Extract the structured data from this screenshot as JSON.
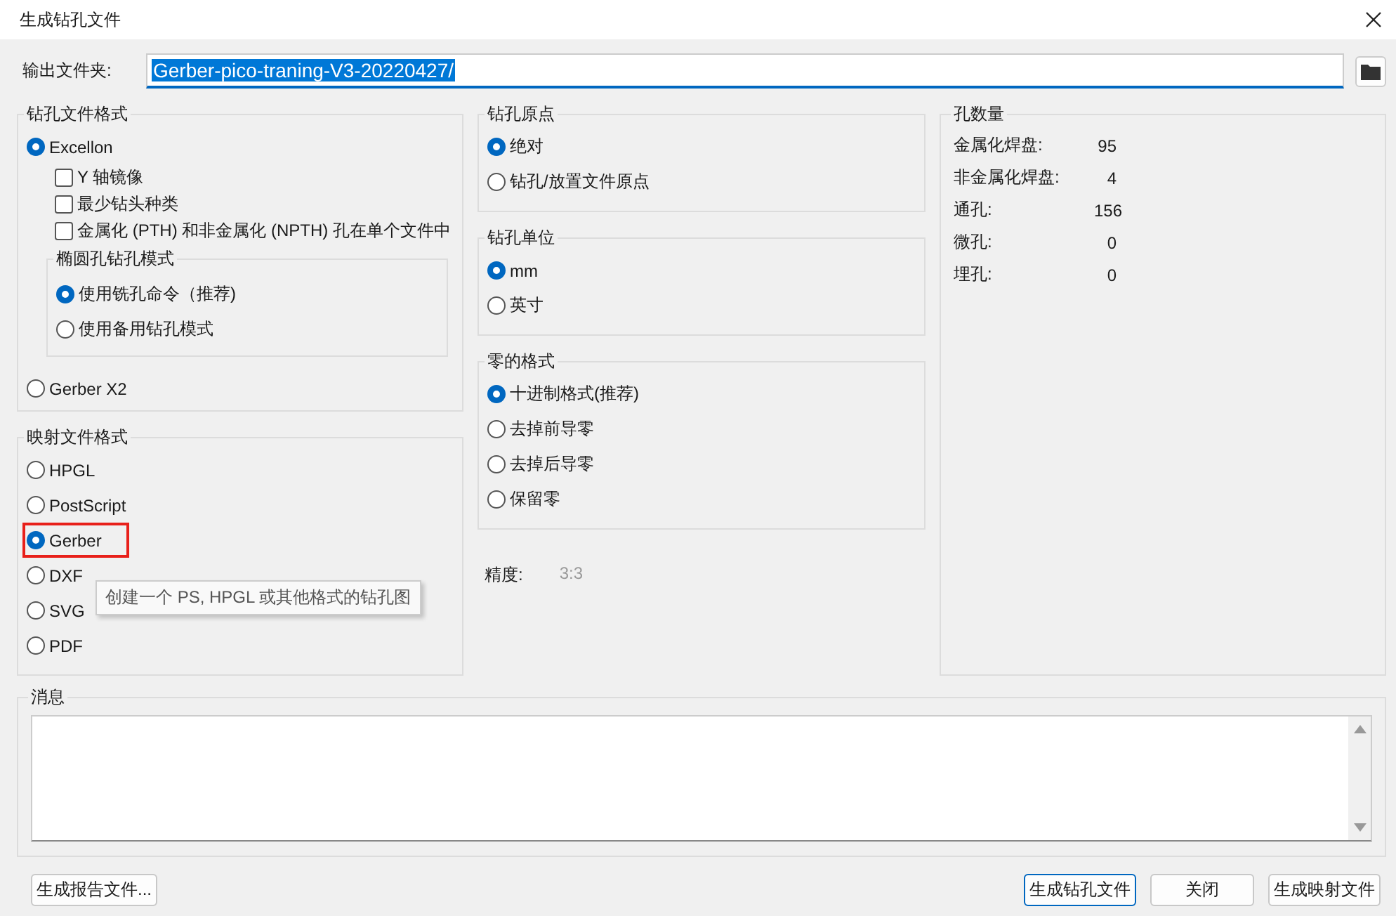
{
  "window": {
    "title": "生成钻孔文件"
  },
  "output_folder": {
    "label": "输出文件夹:",
    "value": "Gerber-pico-traning-V3-20220427/",
    "text_selected": true
  },
  "drill_file_format": {
    "title": "钻孔文件格式",
    "excellon": {
      "label": "Excellon",
      "selected": true
    },
    "checkboxes": [
      {
        "label": "Y 轴镜像",
        "checked": false
      },
      {
        "label": "最少钻头种类",
        "checked": false
      },
      {
        "label": "金属化 (PTH) 和非金属化 (NPTH) 孔在单个文件中",
        "checked": false
      }
    ],
    "oval_mode": {
      "title": "椭圆孔钻孔模式",
      "options": [
        {
          "label": "使用铣孔命令（推荐)",
          "selected": true
        },
        {
          "label": "使用备用钻孔模式",
          "selected": false
        }
      ]
    },
    "gerber_x2": {
      "label": "Gerber X2",
      "selected": false
    }
  },
  "map_file_format": {
    "title": "映射文件格式",
    "options": [
      {
        "label": "HPGL",
        "selected": false,
        "highlighted": false
      },
      {
        "label": "PostScript",
        "selected": false,
        "highlighted": false
      },
      {
        "label": "Gerber",
        "selected": true,
        "highlighted": true
      },
      {
        "label": "DXF",
        "selected": false,
        "highlighted": false
      },
      {
        "label": "SVG",
        "selected": false,
        "highlighted": false
      },
      {
        "label": "PDF",
        "selected": false,
        "highlighted": false
      }
    ]
  },
  "tooltip": {
    "text": "创建一个 PS, HPGL 或其他格式的钻孔图"
  },
  "drill_origin": {
    "title": "钻孔原点",
    "options": [
      {
        "label": "绝对",
        "selected": true
      },
      {
        "label": "钻孔/放置文件原点",
        "selected": false
      }
    ]
  },
  "drill_units": {
    "title": "钻孔单位",
    "options": [
      {
        "label": "mm",
        "selected": true
      },
      {
        "label": "英寸",
        "selected": false
      }
    ]
  },
  "zeros_format": {
    "title": "零的格式",
    "options": [
      {
        "label": "十进制格式(推荐)",
        "selected": true
      },
      {
        "label": "去掉前导零",
        "selected": false
      },
      {
        "label": "去掉后导零",
        "selected": false
      },
      {
        "label": "保留零",
        "selected": false
      }
    ]
  },
  "precision": {
    "label": "精度:",
    "value": "3:3",
    "disabled": true
  },
  "hole_counts": {
    "title": "孔数量",
    "rows": [
      {
        "label": "金属化焊盘:",
        "value": "95"
      },
      {
        "label": "非金属化焊盘:",
        "value": "4"
      },
      {
        "label": "通孔:",
        "value": "156"
      },
      {
        "label": "微孔:",
        "value": "0"
      },
      {
        "label": "埋孔:",
        "value": "0"
      }
    ]
  },
  "messages": {
    "title": "消息"
  },
  "buttons_left": [
    {
      "label": "生成报告文件...",
      "default": false
    }
  ],
  "buttons_right": [
    {
      "label": "生成钻孔文件",
      "default": true
    },
    {
      "label": "关闭",
      "default": false
    },
    {
      "label": "生成映射文件",
      "default": false
    }
  ]
}
